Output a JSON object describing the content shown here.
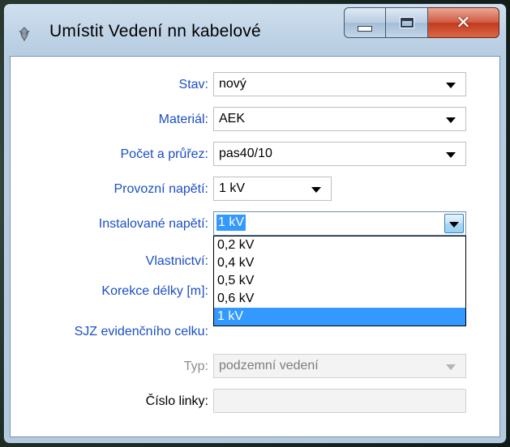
{
  "window": {
    "title": "Umístit Vedení nn kabelové",
    "close_glyph": "✕"
  },
  "form": {
    "stav": {
      "label": "Stav:",
      "value": "nový"
    },
    "material": {
      "label": "Materiál:",
      "value": "AEK"
    },
    "pocet": {
      "label": "Počet a průřez:",
      "value": "pas40/10"
    },
    "provozni": {
      "label": "Provozní napětí:",
      "value": "1 kV"
    },
    "instalovane": {
      "label": "Instalované napětí:",
      "value": "1 kV"
    },
    "vlastnictvi": {
      "label": "Vlastnictví:"
    },
    "korekce": {
      "label": "Korekce délky [m]:"
    },
    "sjz": {
      "label": "SJZ evidenčního celku:"
    },
    "typ": {
      "label": "Typ:",
      "value": "podzemní vedení"
    },
    "cislo": {
      "label": "Číslo linky:",
      "value": ""
    }
  },
  "dropdown": {
    "options": [
      "0,2 kV",
      "0,4 kV",
      "0,5 kV",
      "0,6 kV",
      "1 kV"
    ],
    "selected_index": 4
  },
  "colors": {
    "label_blue": "#1b4fc4",
    "selection": "#3399ff"
  }
}
